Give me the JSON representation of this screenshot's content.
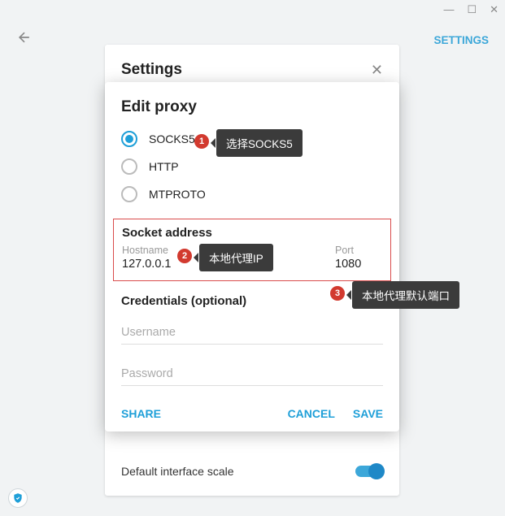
{
  "window": {
    "min": "—",
    "max": "☐",
    "close": "✕"
  },
  "topbar": {
    "settings_link": "SETTINGS"
  },
  "settings": {
    "title": "Settings",
    "interface_scale_label": "Default interface scale"
  },
  "modal": {
    "title": "Edit proxy",
    "radios": {
      "socks5": "SOCKS5",
      "http": "HTTP",
      "mtproto": "MTPROTO"
    },
    "socket_heading": "Socket address",
    "hostname_label": "Hostname",
    "hostname_value": "127.0.0.1",
    "port_label": "Port",
    "port_value": "1080",
    "credentials_heading": "Credentials (optional)",
    "username_placeholder": "Username",
    "password_placeholder": "Password",
    "share": "SHARE",
    "cancel": "CANCEL",
    "save": "SAVE"
  },
  "annotations": {
    "b1": "1",
    "t1": "选择SOCKS5",
    "b2": "2",
    "t2": "本地代理IP",
    "b3": "3",
    "t3": "本地代理默认端口"
  }
}
